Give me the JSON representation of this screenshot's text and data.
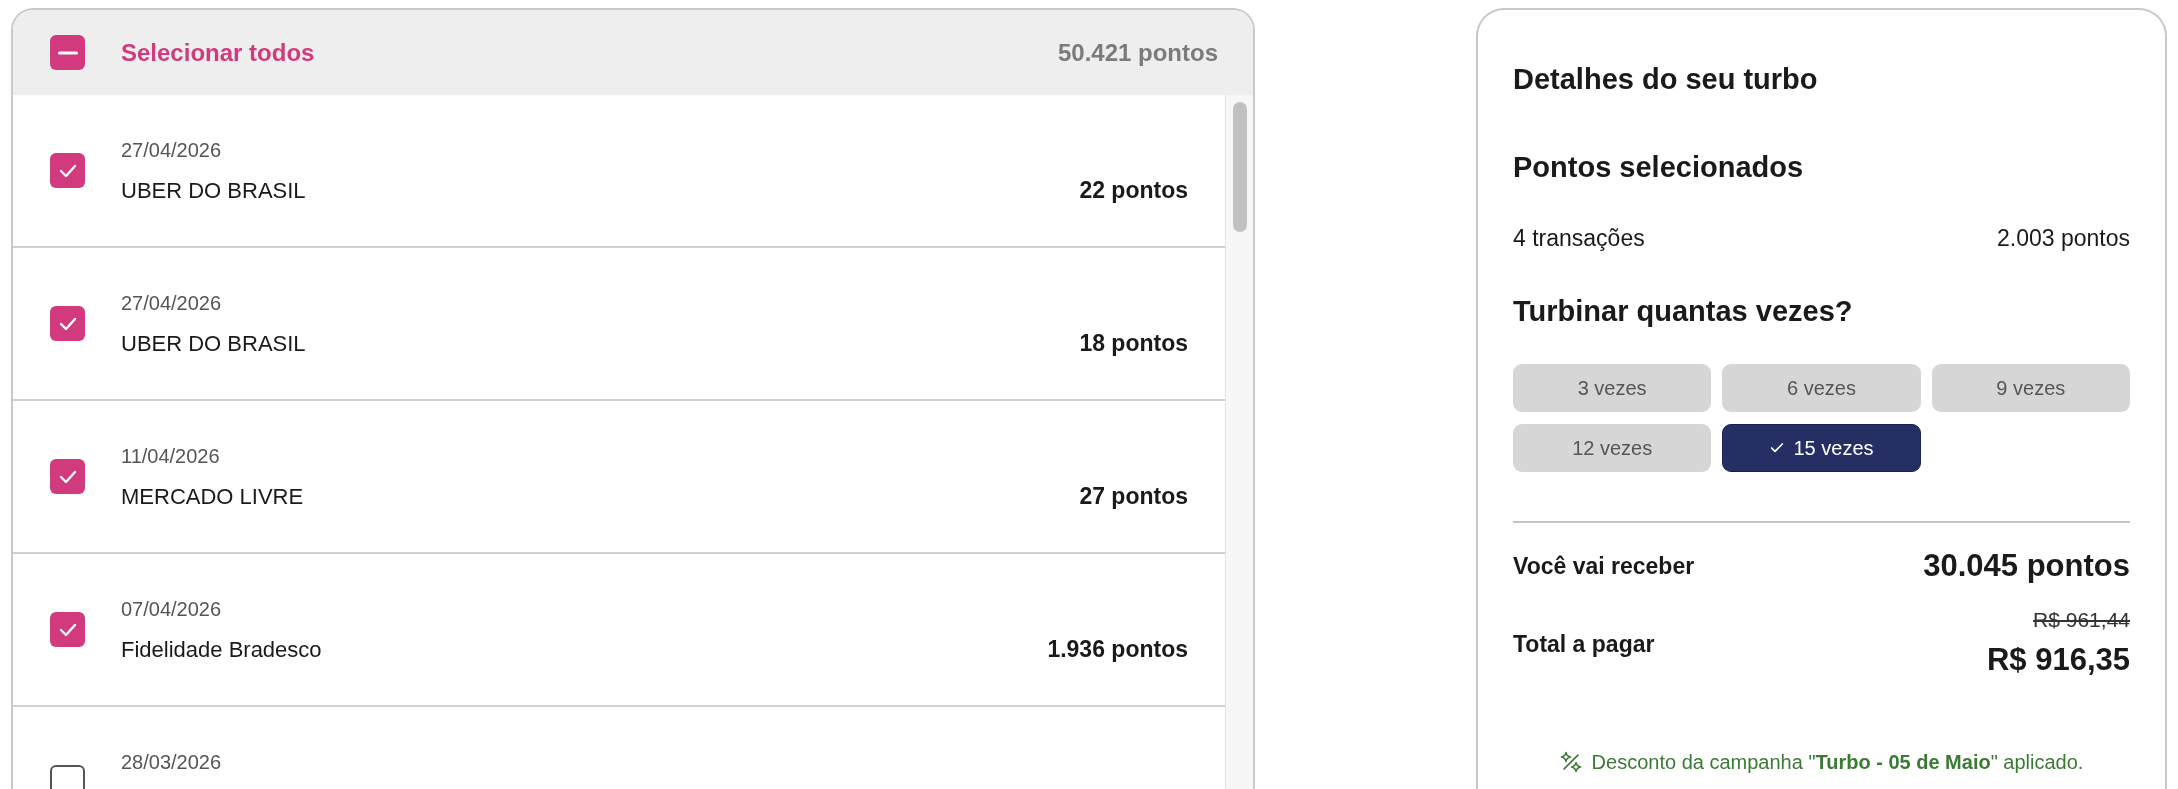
{
  "transactions": {
    "select_all": {
      "label": "Selecionar todos",
      "checked": true,
      "indeterminate": true,
      "total": "50.421 pontos"
    },
    "rows": [
      {
        "date": "27/04/2026",
        "name": "UBER DO BRASIL",
        "points": "22 pontos",
        "checked": true
      },
      {
        "date": "27/04/2026",
        "name": "UBER DO BRASIL",
        "points": "18 pontos",
        "checked": true
      },
      {
        "date": "11/04/2026",
        "name": "MERCADO LIVRE",
        "points": "27 pontos",
        "checked": true
      },
      {
        "date": "07/04/2026",
        "name": "Fidelidade Bradesco",
        "points": "1.936 pontos",
        "checked": true
      },
      {
        "date": "28/03/2026",
        "checked": false
      }
    ]
  },
  "details": {
    "title": "Detalhes do seu turbo",
    "selected_heading": "Pontos selecionados",
    "transaction_count": "4 transações",
    "selected_points": "2.003 pontos",
    "multiplier_heading": "Turbinar quantas vezes?",
    "multiplier_options": [
      {
        "label": "3 vezes",
        "selected": false
      },
      {
        "label": "6 vezes",
        "selected": false
      },
      {
        "label": "9 vezes",
        "selected": false
      },
      {
        "label": "12 vezes",
        "selected": false
      },
      {
        "label": "15 vezes",
        "selected": true
      }
    ],
    "receive_label": "Você vai receber",
    "receive_value": "30.045 pontos",
    "total_label": "Total a pagar",
    "original_price": "R$ 961,44",
    "total_price": "R$ 916,35",
    "discount_note": "Desconto da campanha \"**Turbo - 05 de Maio**\" aplicado."
  }
}
